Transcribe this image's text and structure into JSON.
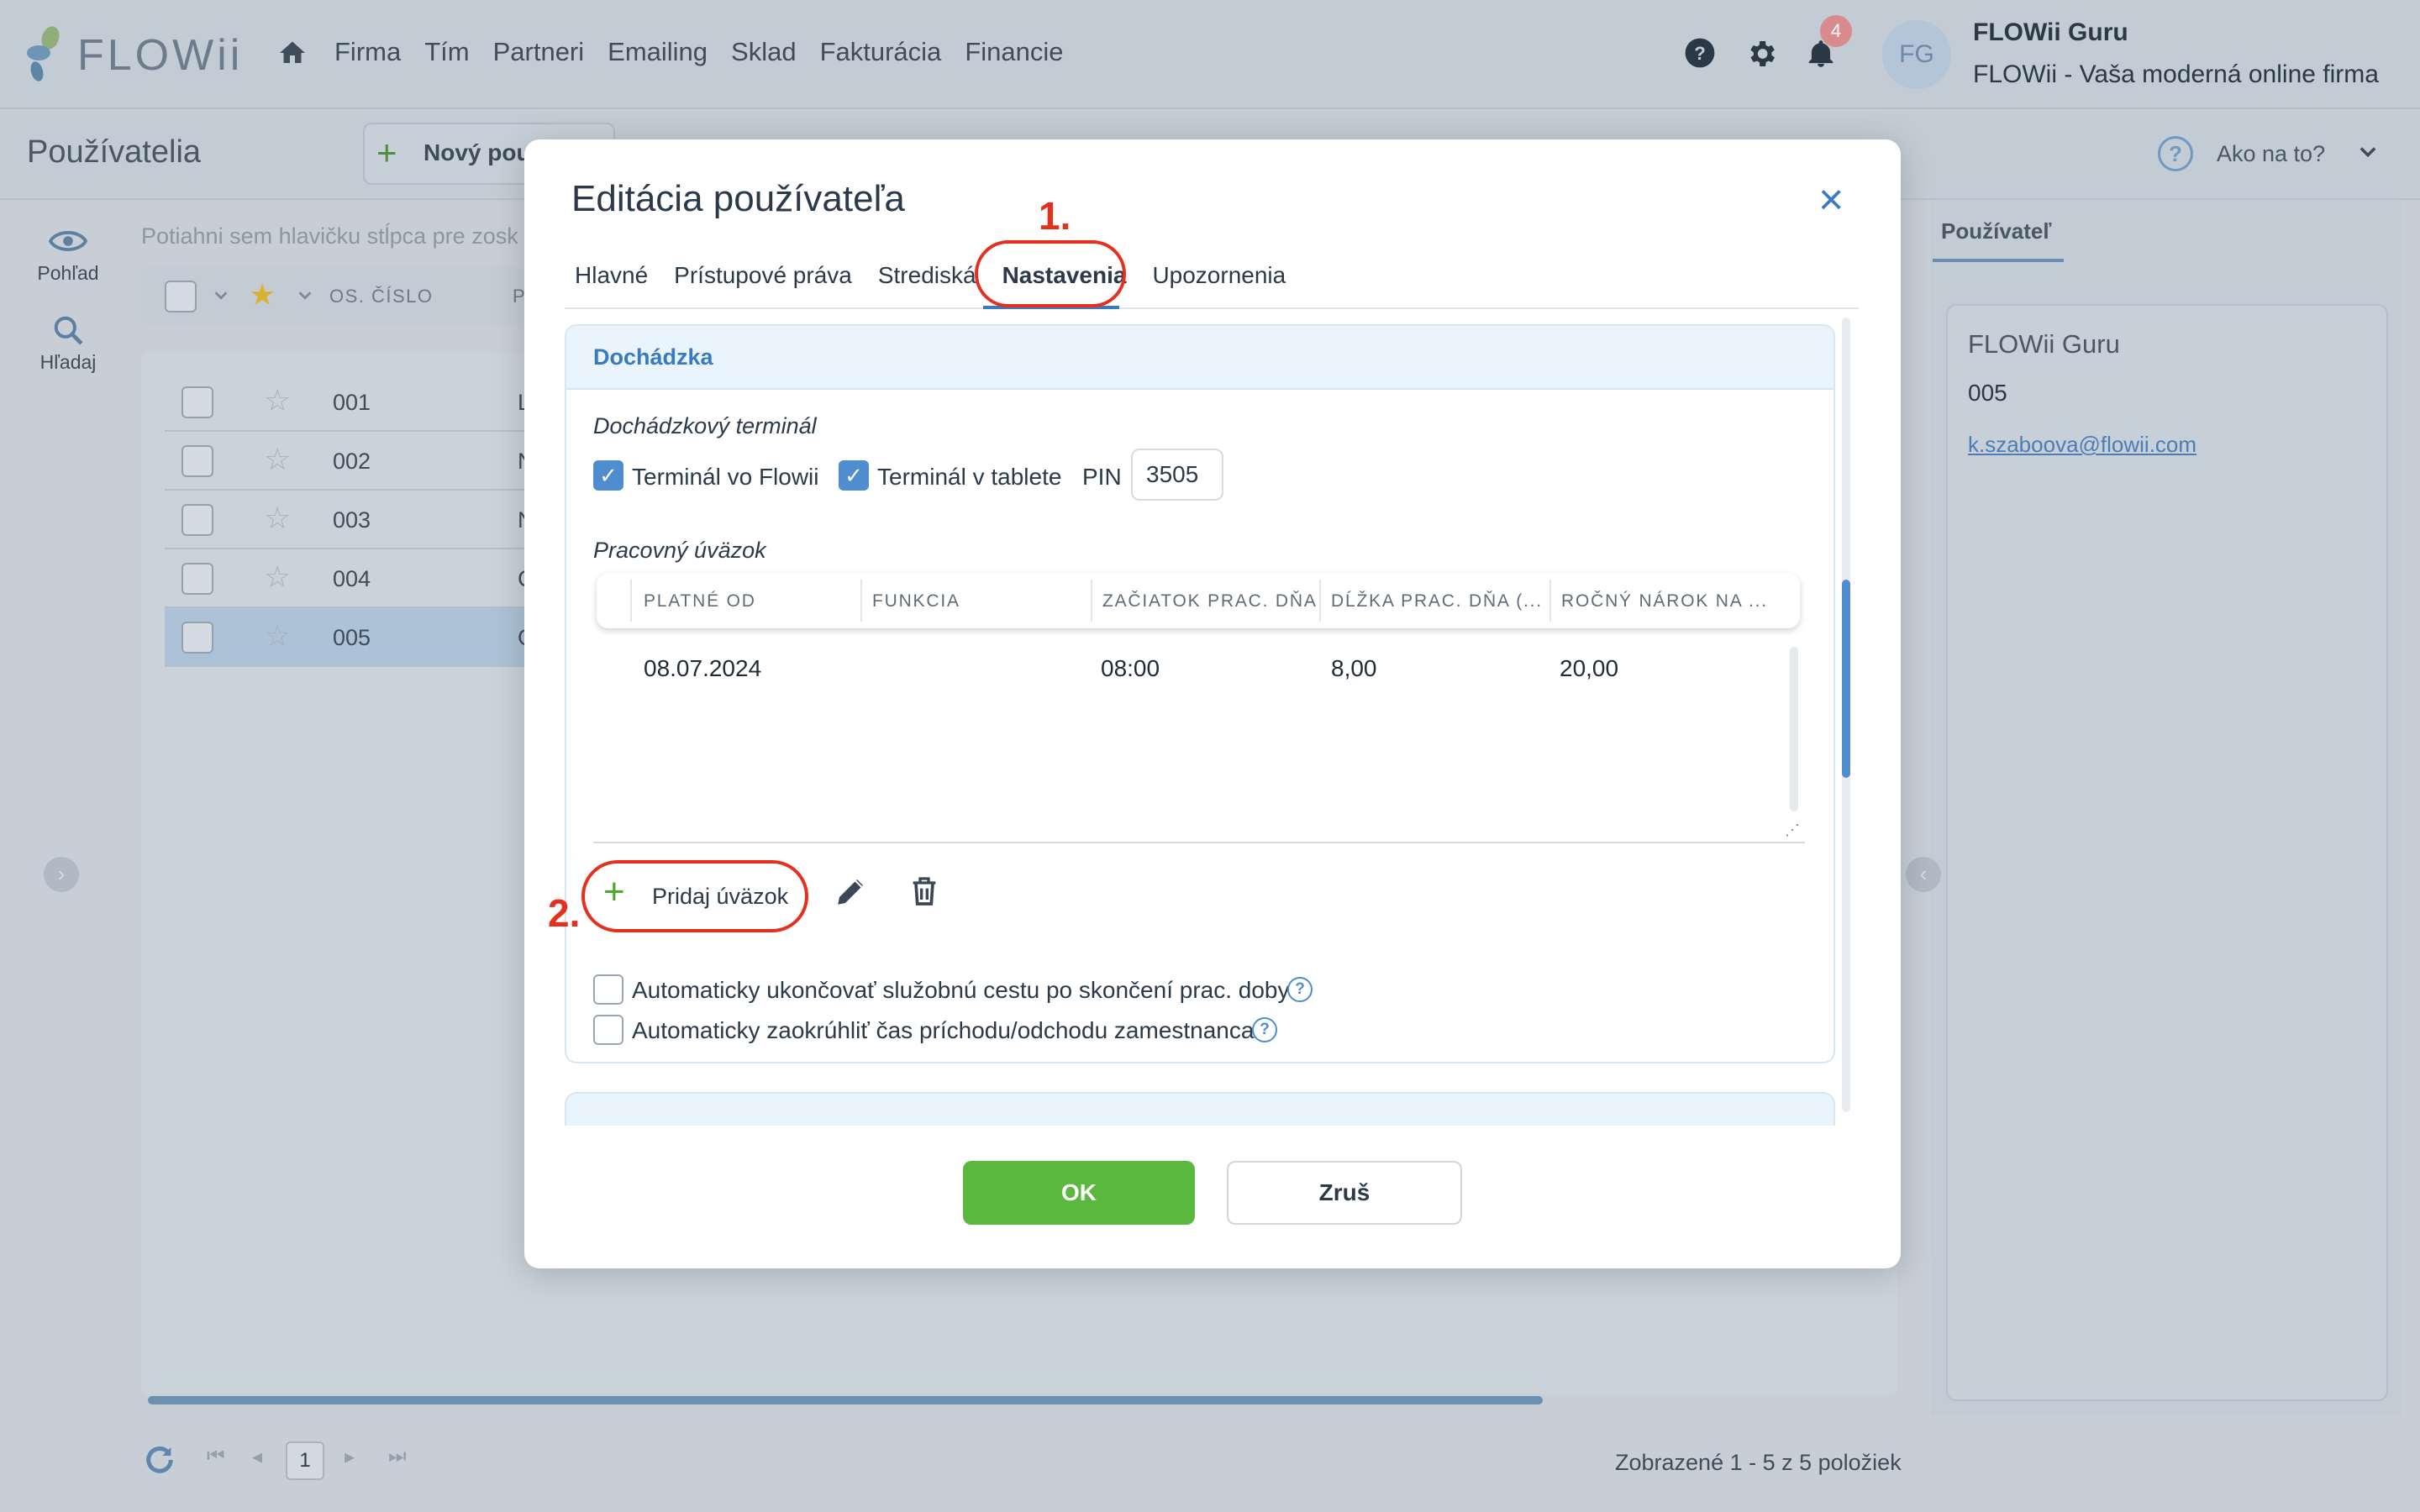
{
  "app": {
    "logo_text": "FLOWii",
    "nav": [
      "Firma",
      "Tím",
      "Partneri",
      "Emailing",
      "Sklad",
      "Fakturácia",
      "Financie"
    ],
    "notification_count": "4",
    "avatar_initials": "FG",
    "user_name": "FLOWii Guru",
    "company_name": "FLOWii - Vaša moderná online firma"
  },
  "page": {
    "title": "Používatelia",
    "new_button_label": "Nový pou",
    "how_to_label": "Ako na to?",
    "left_rail": [
      {
        "label": "Pohľad",
        "icon": "eye-icon"
      },
      {
        "label": "Hľadaj",
        "icon": "search-icon"
      }
    ],
    "drag_hint": "Potiahni sem hlavičku stĺpca pre zosk",
    "grid_column_label": "OS. ČÍSLO",
    "grid_column_label_partial": "P",
    "rows": [
      {
        "num": "001",
        "initial": "L",
        "selected": false
      },
      {
        "num": "002",
        "initial": "N",
        "selected": false
      },
      {
        "num": "003",
        "initial": "N",
        "selected": false
      },
      {
        "num": "004",
        "initial": "C",
        "selected": false
      },
      {
        "num": "005",
        "initial": "G",
        "selected": true
      }
    ],
    "current_page": "1",
    "shown_text": "Zobrazené 1 - 5 z 5 položiek"
  },
  "right_panel": {
    "tab_label": "Používateľ",
    "name": "FLOWii Guru",
    "number": "005",
    "email": "k.szaboova@flowii.com"
  },
  "modal": {
    "title": "Editácia používateľa",
    "tabs": [
      {
        "label": "Hlavné",
        "active": false
      },
      {
        "label": "Prístupové práva",
        "active": false
      },
      {
        "label": "Strediská",
        "active": false
      },
      {
        "label": "Nastavenia",
        "active": true
      },
      {
        "label": "Upozornenia",
        "active": false
      }
    ],
    "section_title": "Dochádzka",
    "terminal_label": "Dochádzkový terminál",
    "terminal_flowii": {
      "label": "Terminál vo Flowii",
      "checked": true
    },
    "terminal_tablet": {
      "label": "Terminál v tablete",
      "checked": true
    },
    "pin_label": "PIN",
    "pin_value": "3505",
    "workload_label": "Pracovný úväzok",
    "table": {
      "columns": [
        "PLATNÉ OD",
        "FUNKCIA",
        "ZAČIATOK PRAC. DŇA",
        "DĹŽKA PRAC. DŇA (...",
        "ROČNÝ NÁROK NA ..."
      ],
      "rows": [
        {
          "valid_from": "08.07.2024",
          "function": "",
          "start": "08:00",
          "length": "8,00",
          "annual": "20,00"
        }
      ]
    },
    "add_workload_label": "Pridaj úväzok",
    "auto_end_trip": {
      "label": "Automaticky ukončovať služobnú cestu po skončení prac. doby",
      "checked": false
    },
    "auto_round": {
      "label": "Automaticky zaokrúhliť čas príchodu/odchodu zamestnanca",
      "checked": false
    },
    "ok_label": "OK",
    "cancel_label": "Zruš"
  },
  "annotations": {
    "step1": "1.",
    "step2": "2.",
    "color": "#e6301e"
  },
  "colors": {
    "accent": "#3a7bc0",
    "ok_green": "#5bb83e",
    "add_plus_green": "#4aa933"
  }
}
